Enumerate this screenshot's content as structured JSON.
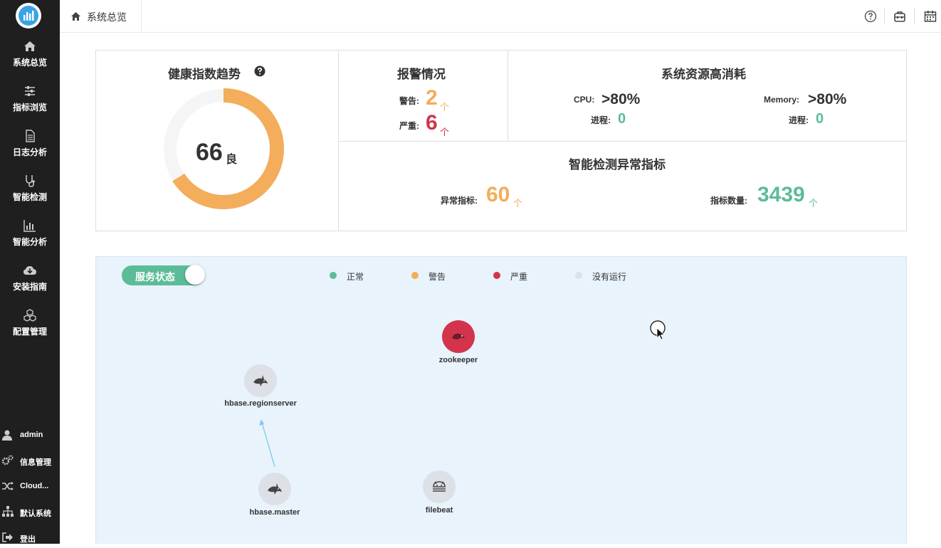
{
  "sidebar": {
    "items": [
      {
        "label": "系统总览",
        "icon": "home-icon"
      },
      {
        "label": "指标浏览",
        "icon": "sliders-icon"
      },
      {
        "label": "日志分析",
        "icon": "document-icon"
      },
      {
        "label": "智能检测",
        "icon": "stethoscope-icon"
      },
      {
        "label": "智能分析",
        "icon": "bar-chart-icon"
      },
      {
        "label": "安装指南",
        "icon": "cloud-download-icon"
      },
      {
        "label": "配置管理",
        "icon": "cubes-icon"
      }
    ],
    "bottom": [
      {
        "label": "admin",
        "icon": "user-icon"
      },
      {
        "label": "信息管理",
        "icon": "gears-icon"
      },
      {
        "label": "Cloud...",
        "icon": "shuffle-icon"
      },
      {
        "label": "默认系统",
        "icon": "sitemap-icon"
      },
      {
        "label": "登出",
        "icon": "logout-icon"
      }
    ]
  },
  "header": {
    "breadcrumb": "系统总览",
    "icons": [
      "help-icon",
      "toolbox-icon",
      "calendar-icon"
    ]
  },
  "health": {
    "title": "健康指数趋势",
    "score": "66",
    "grade": "良",
    "gauge_fraction": 0.66,
    "gauge_color": "#f3ad5b"
  },
  "alarm": {
    "title": "报警情况",
    "warning_label": "警告:",
    "warning_value": "2",
    "critical_label": "严重:",
    "critical_value": "6",
    "unit": "个"
  },
  "resource": {
    "title": "系统资源高消耗",
    "cpu_label": "CPU:",
    "cpu_value": ">80%",
    "cpu_proc_label": "进程:",
    "cpu_proc_value": "0",
    "mem_label": "Memory:",
    "mem_value": ">80%",
    "mem_proc_label": "进程:",
    "mem_proc_value": "0"
  },
  "anomaly": {
    "title": "智能检测异常指标",
    "abnormal_label": "异常指标:",
    "abnormal_value": "60",
    "total_label": "指标数量:",
    "total_value": "3439",
    "unit": "个"
  },
  "topology": {
    "toggle_label": "服务状态",
    "legend": [
      {
        "label": "正常",
        "color": "#5cbc97"
      },
      {
        "label": "警告",
        "color": "#f3ad5b"
      },
      {
        "label": "严重",
        "color": "#d3344b"
      },
      {
        "label": "没有运行",
        "color": "#dde1e7"
      }
    ],
    "nodes": [
      {
        "name": "zookeeper",
        "status": "严重",
        "icon": "zookeeper-icon"
      },
      {
        "name": "hbase.regionserver",
        "status": "没有运行",
        "icon": "orca-icon"
      },
      {
        "name": "hbase.master",
        "status": "没有运行",
        "icon": "orca-icon"
      },
      {
        "name": "filebeat",
        "status": "没有运行",
        "icon": "android-icon"
      }
    ]
  },
  "colors": {
    "orange": "#f3ad5b",
    "red": "#d3344b",
    "green": "#5cbc97",
    "sidebar": "#1f1f1f"
  }
}
